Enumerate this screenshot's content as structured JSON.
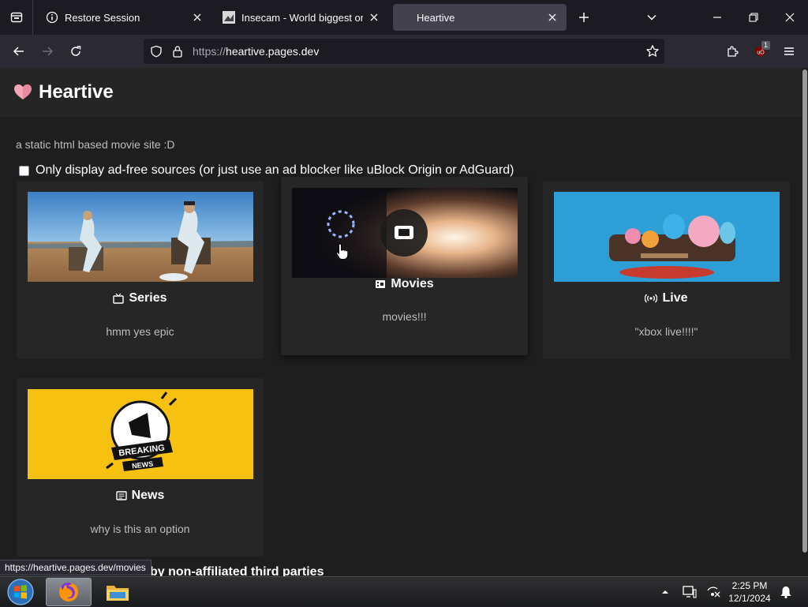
{
  "browser": {
    "tabs": [
      {
        "title": "Restore Session",
        "icon": "info-icon",
        "active": false
      },
      {
        "title": "Insecam - World biggest online",
        "icon": "page-favicon",
        "active": false
      },
      {
        "title": "Heartive",
        "icon": "",
        "active": true
      }
    ],
    "url": {
      "protocol": "https://",
      "host": "heartive.pages.dev"
    },
    "extension_badge": "1",
    "status_url": "https://heartive.pages.dev/movies"
  },
  "site": {
    "title": "Heartive",
    "tagline": "a static html based movie site :D",
    "adfree_label": "Only display ad-free sources (or just use an ad blocker like uBlock Origin or AdGuard)",
    "adfree_checked": false,
    "cards": [
      {
        "title": "Series",
        "desc": "hmm yes epic",
        "icon": "tv-icon"
      },
      {
        "title": "Movies",
        "desc": "movies!!!",
        "icon": "film-icon"
      },
      {
        "title": "Live",
        "desc": "\"xbox live!!!!\"",
        "icon": "broadcast-icon"
      },
      {
        "title": "News",
        "desc": "why is this an option",
        "icon": "newspaper-icon"
      }
    ],
    "footer_peek": "by non-affiliated third parties"
  },
  "taskbar": {
    "time": "2:25 PM",
    "date": "12/1/2024"
  },
  "colors": {
    "page_bg": "#1e1e1e",
    "card_bg": "#262626",
    "header_bg": "#252525",
    "heart": "#f3a6b8"
  }
}
